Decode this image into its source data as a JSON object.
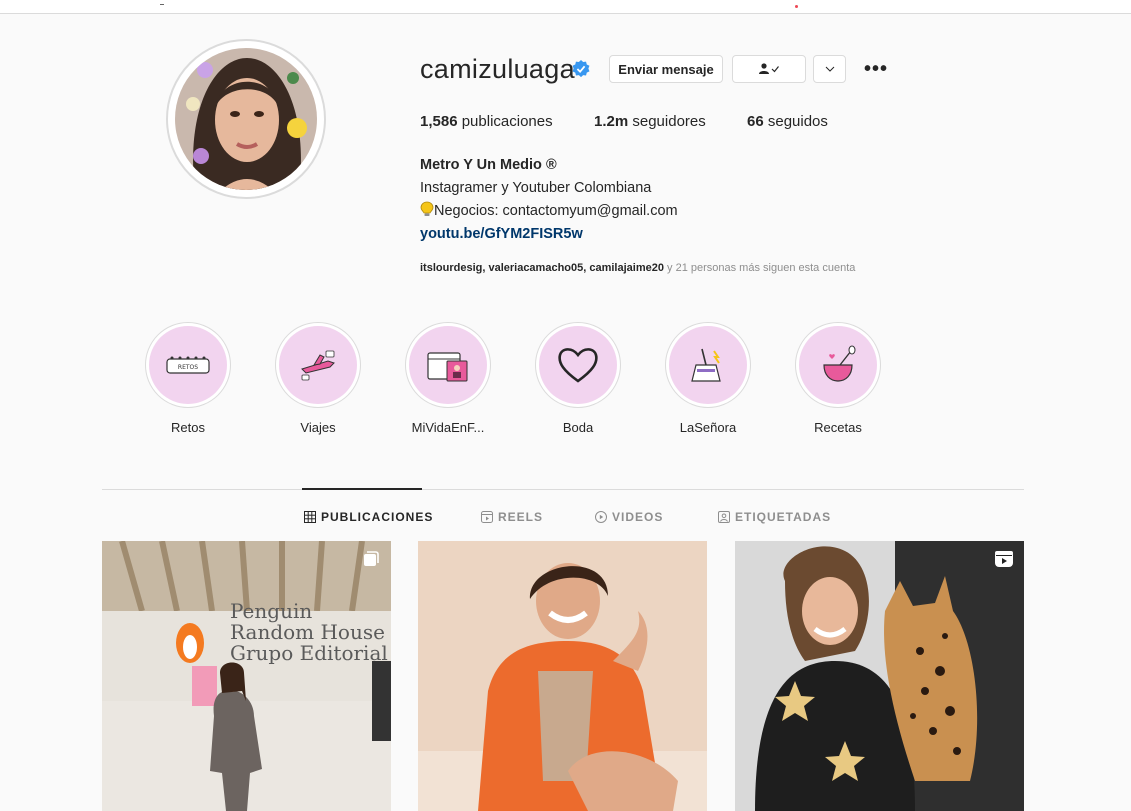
{
  "profile": {
    "username": "camizuluaga",
    "verified": true,
    "accent_color": "#3897f0",
    "buttons": {
      "message": "Enviar mensaje",
      "follow_icon": "person-check-icon",
      "more_icon": "chevron-down-icon",
      "options": "•••"
    },
    "stats": {
      "posts_count": "1,586",
      "posts_label": "publicaciones",
      "followers_count": "1.2m",
      "followers_label": "seguidores",
      "following_count": "66",
      "following_label": "seguidos"
    },
    "bio": {
      "name": "Metro Y Un Medio ®",
      "line1": "Instagramer y Youtuber Colombiana",
      "line2": "Negocios: contactomyum@gmail.com",
      "link": "youtu.be/GfYM2FISR5w"
    },
    "followed_by": {
      "names": "itslourdesig, valeriacamacho05, camilajaime20",
      "rest": " y 21 personas más siguen esta cuenta"
    }
  },
  "highlights": [
    {
      "label": "Retos",
      "icon": "retos-sign-icon"
    },
    {
      "label": "Viajes",
      "icon": "airplane-icon"
    },
    {
      "label": "MiVidaEnF...",
      "icon": "calendar-photo-icon"
    },
    {
      "label": "Boda",
      "icon": "heart-icon"
    },
    {
      "label": "LaSeñora",
      "icon": "broom-icon"
    },
    {
      "label": "Recetas",
      "icon": "mixing-bowl-icon"
    }
  ],
  "tabs": [
    {
      "label": "PUBLICACIONES",
      "icon": "grid-icon",
      "active": true
    },
    {
      "label": "REELS",
      "icon": "reels-icon",
      "active": false
    },
    {
      "label": "VIDEOS",
      "icon": "play-icon",
      "active": false
    },
    {
      "label": "ETIQUETADAS",
      "icon": "tag-icon",
      "active": false
    }
  ],
  "posts": [
    {
      "type": "carousel",
      "icon": "carousel-icon",
      "sign_text": [
        "Penguin",
        "Random House",
        "Grupo Editorial"
      ]
    },
    {
      "type": "photo"
    },
    {
      "type": "reel",
      "icon": "reels-icon"
    }
  ]
}
